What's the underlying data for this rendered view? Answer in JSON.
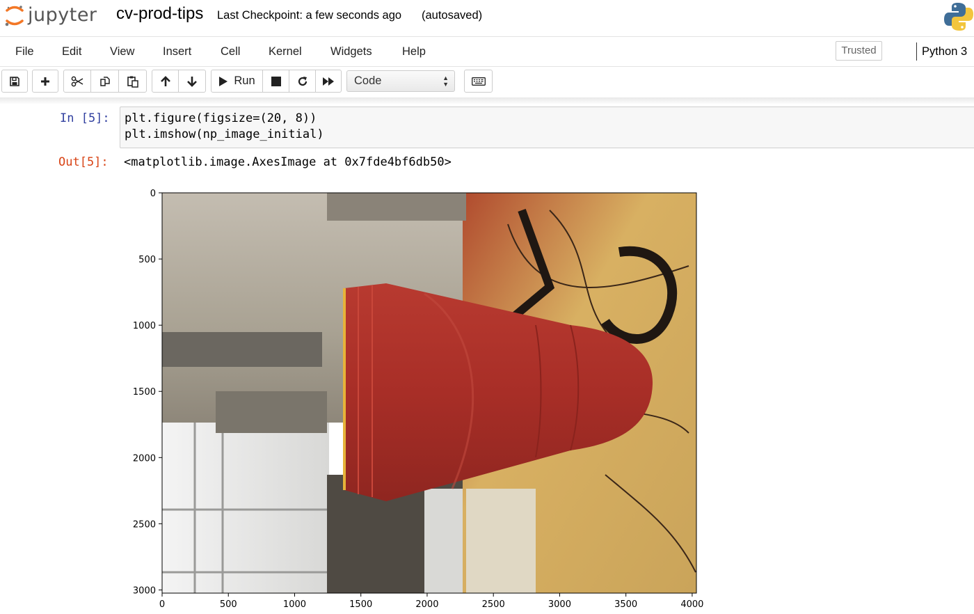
{
  "header": {
    "logo_text": "jupyter",
    "notebook_title": "cv-prod-tips",
    "checkpoint": "Last Checkpoint: a few seconds ago",
    "autosave_status": "(autosaved)"
  },
  "menubar": {
    "items": [
      "File",
      "Edit",
      "View",
      "Insert",
      "Cell",
      "Kernel",
      "Widgets",
      "Help"
    ],
    "trusted_label": "Trusted",
    "kernel_name": "Python 3"
  },
  "toolbar": {
    "run_label": "Run",
    "cell_type": "Code",
    "icons": [
      "save-icon",
      "plus-icon",
      "cut-icon",
      "copy-icon",
      "paste-icon",
      "arrow-up-icon",
      "arrow-down-icon",
      "run-icon",
      "stop-icon",
      "restart-icon",
      "fast-forward-icon",
      "keyboard-icon"
    ]
  },
  "cell": {
    "in_prompt": "In [5]:",
    "code_lines": [
      "plt.figure(figsize=(20, 8))",
      "plt.imshow(np_image_initial)"
    ],
    "out_prompt": "Out[5]:",
    "output_text": "<matplotlib.image.AxesImage at 0x7fde4bf6db50>"
  },
  "chart_data": {
    "type": "image",
    "x_ticks": [
      "0",
      "500",
      "1000",
      "1500",
      "2000",
      "2500",
      "3000",
      "3500",
      "4000"
    ],
    "y_ticks": [
      "0",
      "500",
      "1000",
      "1500",
      "2000",
      "2500",
      "3000"
    ],
    "xlim": [
      0,
      4032
    ],
    "ylim": [
      3024,
      0
    ],
    "image_subject": "red plastic cup lying sideways in front of a stone wall and graffiti",
    "colors": {
      "cup": "#a8302a",
      "wall": "#b9b2a4",
      "graffiti": "#c79a4a"
    }
  }
}
